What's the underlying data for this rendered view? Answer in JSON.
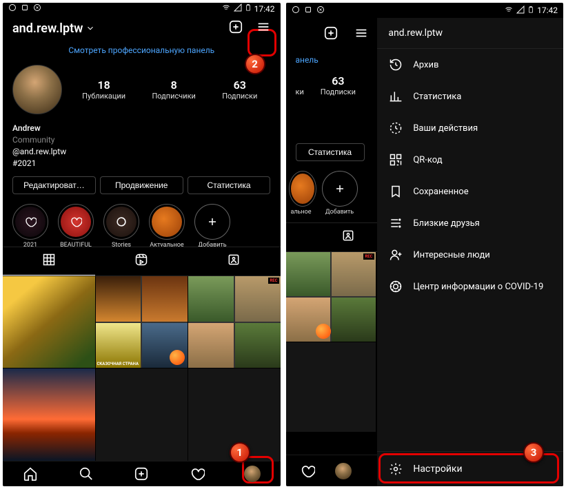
{
  "status": {
    "time": "17:42"
  },
  "left": {
    "username": "and.rew.lptw",
    "pro_panel": "Смотреть профессиональную панель",
    "stats": {
      "posts_num": "18",
      "posts_label": "Публикации",
      "followers_num": "8",
      "followers_label": "Подписчики",
      "following_num": "63",
      "following_label": "Подписки"
    },
    "bio": {
      "name": "Andrew",
      "category": "Community",
      "handle": "@and.rew.lptw",
      "tag": "#2021"
    },
    "actions": {
      "edit": "Редактироват…",
      "promote": "Продвижение",
      "stats": "Статистика"
    },
    "highlights": [
      {
        "label": "2021"
      },
      {
        "label": "BEAUTIFUL"
      },
      {
        "label": "Stories"
      },
      {
        "label": "Актуальное"
      },
      {
        "label": "Добавить"
      }
    ],
    "collage_text": "СКАЗОЧНАЯ СТРАНА"
  },
  "right": {
    "visible": {
      "pro_tail": "анель",
      "followers_tail": "ки",
      "following_num": "63",
      "following_label": "Подписки",
      "stats_btn": "Статистика",
      "hl_tail": "альное",
      "hl_add": "Добавить"
    },
    "menu": {
      "header": "and.rew.lptw",
      "items": [
        {
          "label": "Архив",
          "icon": "history-icon"
        },
        {
          "label": "Статистика",
          "icon": "bar-chart-icon"
        },
        {
          "label": "Ваши действия",
          "icon": "activity-icon"
        },
        {
          "label": "QR-код",
          "icon": "qr-icon"
        },
        {
          "label": "Сохраненное",
          "icon": "bookmark-icon"
        },
        {
          "label": "Близкие друзья",
          "icon": "close-friends-icon"
        },
        {
          "label": "Интересные люди",
          "icon": "people-suggest-icon"
        },
        {
          "label": "Центр информации о COVID-19",
          "icon": "covid-info-icon"
        }
      ],
      "footer": "Настройки"
    }
  },
  "badges": {
    "one": "1",
    "two": "2",
    "three": "3"
  }
}
